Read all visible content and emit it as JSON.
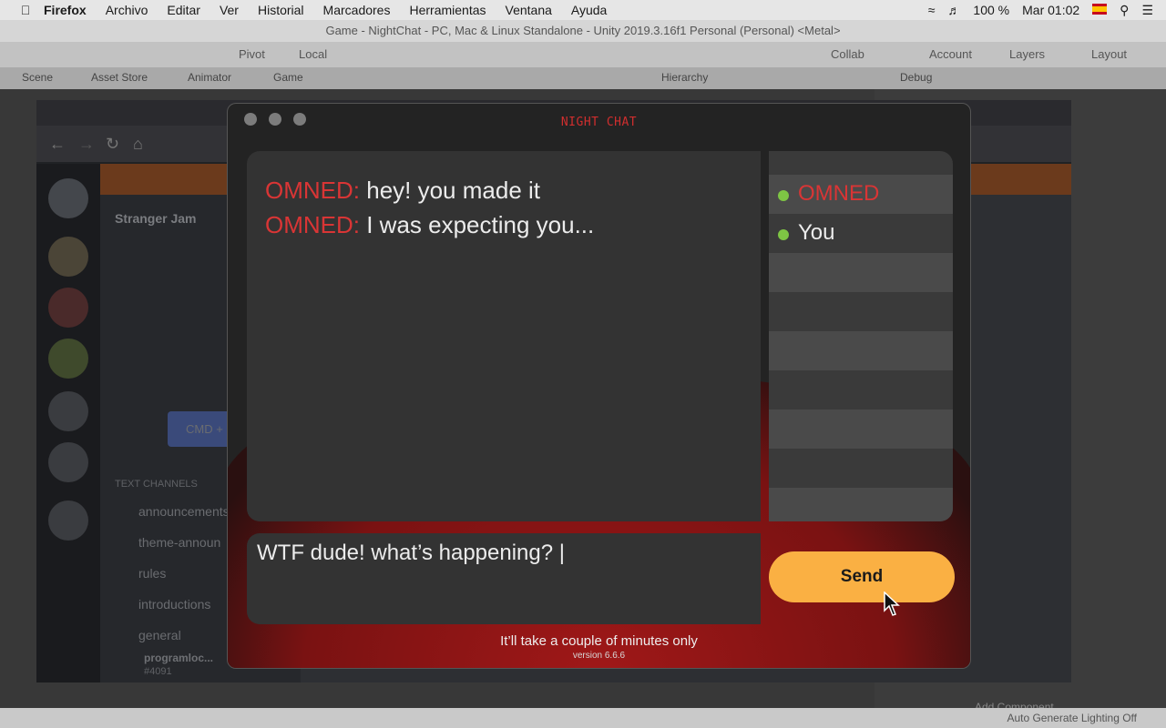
{
  "menubar": {
    "app": "Firefox",
    "items": [
      "Archivo",
      "Editar",
      "Ver",
      "Historial",
      "Marcadores",
      "Herramientas",
      "Ventana",
      "Ayuda"
    ],
    "battery": "100 %",
    "clock": "Mar 01:02"
  },
  "unity": {
    "window_title": "Game - NightChat - PC, Mac & Linux Standalone - Unity 2019.3.16f1 Personal (Personal) <Metal>",
    "toolbar": {
      "pivot": "Pivot",
      "local": "Local",
      "collab": "Collab",
      "account": "Account",
      "layers": "Layers",
      "layout": "Layout"
    },
    "tabs": [
      "Scene",
      "Asset Store",
      "Animator",
      "Game"
    ],
    "hierarchy_tab": "Hierarchy",
    "debug_tab": "Debug",
    "add_component": "Add Component",
    "status": "Auto Generate Lighting Off"
  },
  "discord": {
    "server_name": "Stranger Jam",
    "text_channels_header": "TEXT CHANNELS",
    "channels": [
      "announcements",
      "theme-announ",
      "rules",
      "introductions",
      "general"
    ],
    "user": {
      "name": "programloc...",
      "tag": "#4091"
    },
    "cmd_label": "CMD +"
  },
  "game": {
    "title": "NIGHT CHAT",
    "messages": [
      {
        "sender": "OMNED:",
        "text": "hey! you made it"
      },
      {
        "sender": "OMNED:",
        "text": "I was expecting you..."
      }
    ],
    "users": [
      {
        "name": "OMNED"
      },
      {
        "name": "You"
      }
    ],
    "input_value": "WTF dude! what’s happening? |",
    "send_label": "Send",
    "hint": "It’ll take a couple of minutes only",
    "version": "version 6.6.6"
  },
  "colors": {
    "accent_red": "#d93535",
    "send_yellow": "#fab043",
    "online_green": "#7ec544"
  }
}
